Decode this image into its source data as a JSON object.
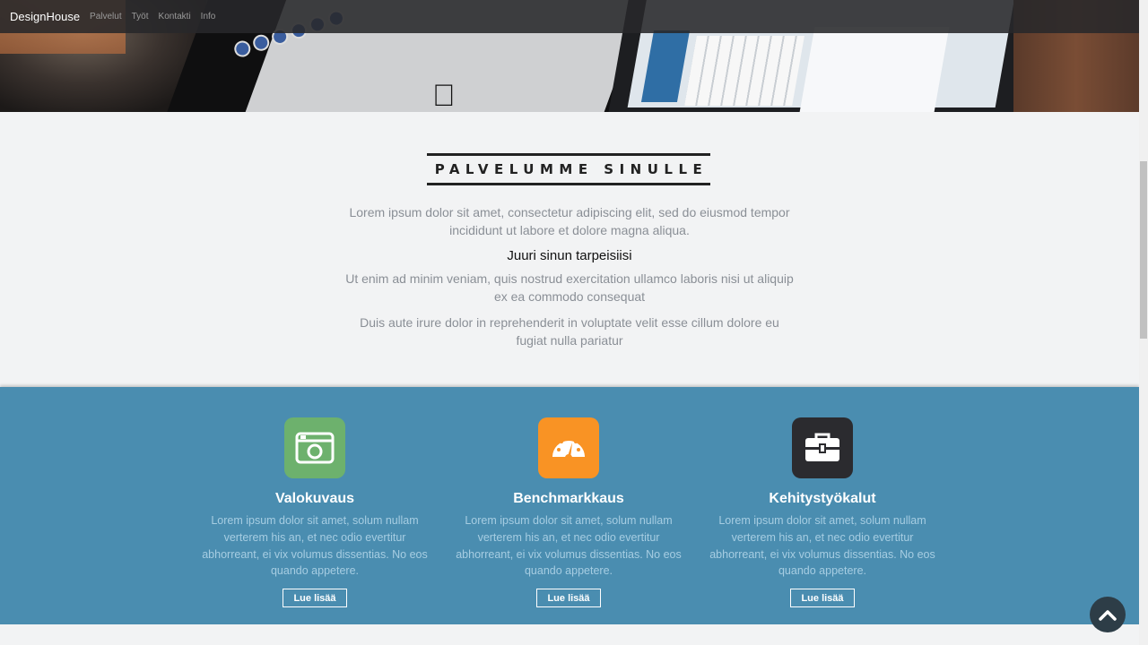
{
  "navbar": {
    "brand": "DesignHouse",
    "links": [
      "Palvelut",
      "Työt",
      "Kontakti",
      "Info"
    ]
  },
  "intro": {
    "heading": "PALVELUMME SINULLE",
    "p1_line1": "Lorem ipsum dolor sit amet, consectetur adipiscing elit, sed do eiusmod tempor",
    "p1_line2": "incididunt ut labore et dolore magna aliqua.",
    "subheading": "Juuri sinun tarpeisiisi",
    "p2_line1": "Ut enim ad minim veniam, quis nostrud exercitation ullamco laboris nisi ut aliquip",
    "p2_line2": "ex ea commodo consequat",
    "p3_line1": "Duis aute irure dolor in reprehenderit in voluptate velit esse cillum dolore eu",
    "p3_line2": "fugiat nulla pariatur"
  },
  "features": [
    {
      "title": "Valokuvaus",
      "icon": "camera-icon",
      "color": "#6db16d",
      "text_lines": [
        "Lorem ipsum dolor sit amet, solum nullam",
        "verterem his an, et nec odio evertitur",
        "abhorreant, ei vix volumus dissentias. No eos",
        "quando appetere."
      ],
      "button": "Lue lisää"
    },
    {
      "title": "Benchmarkkaus",
      "icon": "speedometer-icon",
      "color": "#f99324",
      "text_lines": [
        "Lorem ipsum dolor sit amet, solum nullam",
        "verterem his an, et nec odio evertitur",
        "abhorreant, ei vix volumus dissentias. No eos",
        "quando appetere."
      ],
      "button": "Lue lisää"
    },
    {
      "title": "Kehitystyökalut",
      "icon": "briefcase-icon",
      "color": "#2b2b2f",
      "text_lines": [
        "Lorem ipsum dolor sit amet, solum nullam",
        "verterem his an, et nec odio evertitur",
        "abhorreant, ei vix volumus dissentias. No eos",
        "quando appetere."
      ],
      "button": "Lue lisää"
    }
  ],
  "colors": {
    "band": "#4a8db0",
    "navbar": "#28282a",
    "scroll_top": "#2d3d47"
  }
}
